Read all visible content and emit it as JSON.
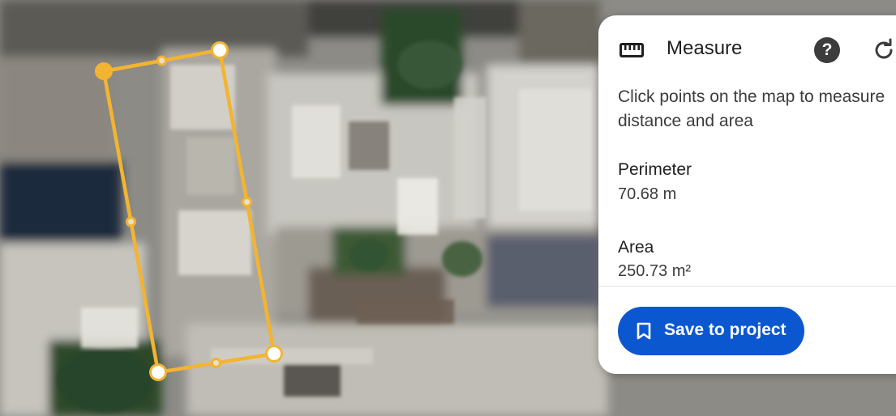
{
  "panel": {
    "title": "Measure",
    "icon": "ruler-icon",
    "help_icon": "help-icon",
    "reset_icon": "reset-icon",
    "help_glyph": "?",
    "instructions": "Click points on the map to measure distance and area",
    "perimeter_label": "Perimeter",
    "perimeter_value": "70.68 m",
    "area_label": "Area",
    "area_value": "250.73 m²",
    "save_label": "Save to project",
    "save_icon": "bookmark-icon"
  },
  "colors": {
    "measure_line": "#f2b431",
    "accent": "#0b57d0"
  }
}
